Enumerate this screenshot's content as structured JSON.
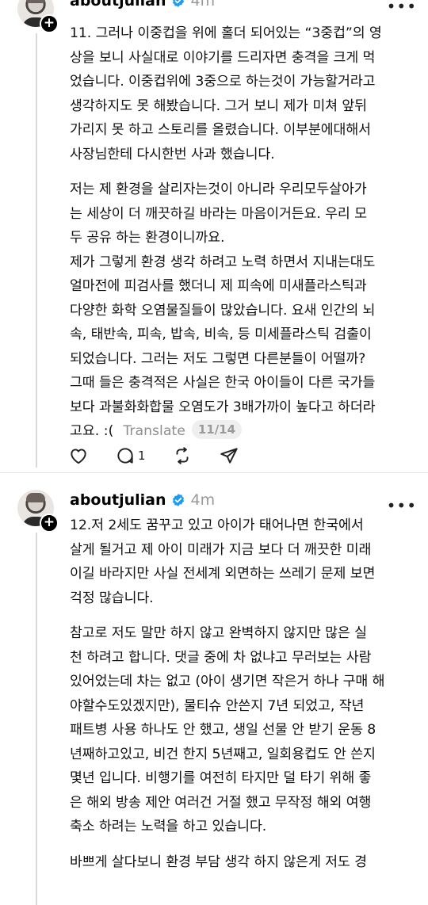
{
  "post1": {
    "username": "aboutjulian",
    "time": "4m",
    "paragraphs": [
      "11. 그러나 이중컵을 위에 홀더 되어있는 “3중컵”의 영\n상을 보니 사실대로 이야기를 드리자면 충격을 크게 먹\n었습니다. 이중컵위에 3중으로 하는것이 가능할거라고\n생각하지도 못 해봤습니다. 그거 보니 제가 미쳐 앞뒤\n가리지 못 하고 스토리를 올렸습니다. 이부분에대해서\n사장님한테 다시한번 사과 했습니다.",
      "저는 제 환경을 살리자는것이 아니라 우리모두살아가\n는 세상이 더 깨끗하길 바라는 마음이거든요. 우리 모\n두 공유 하는 환경이니까요.\n제가 그렇게 환경 생각 하려고 노력 하면서 지내는대도\n얼마전에 피검사를 했더니 제 피속에 미새플라스틱과\n다양한 화학 오염물질들이 많았습니다. 요새 인간의 뇌\n속, 태반속, 피속, 밥속, 비속, 등 미세플라스틱 검출이\n되었습니다. 그러는 저도 그렇면 다른분들이 어떨까?\n그때 들은 충격적은 사실은 한국 아이들이 다른 국가들\n보다 과불화화합물 오염도가 3배가까이 높다고 하더라"
    ],
    "last_line": "고요. :(",
    "translate_label": "Translate",
    "page_indicator": "11/14",
    "reply_count": "1"
  },
  "post2": {
    "username": "aboutjulian",
    "time": "4m",
    "paragraphs": [
      "12.저 2세도 꿈꾸고 있고 아이가 태어나면 한국에서\n살게 될거고 제 아이 미래가 지금 보다 더 깨끗한 미래\n이길 바라지만 사실 전세계 외면하는 쓰레기 문제 보면\n걱정 많습니다.",
      "참고로 저도 말만 하지 않고 완벽하지 않지만 많은 실\n천 하려고 합니다. 댓글 중에 차 없냐고 무러보는 사람\n있어었는데 차는 없고 (아이 생기면 작은거 하나 구매 해\n야할수도있겠지만), 물티슈 안쓴지 7년 되었고, 작년\n패트병 사용 하나도 안 했고, 생일 선물 안 받기 운동 8\n년째하고있고, 비건 한지 5년째고, 일회용컵도 안 쓴지\n몇년 입니다. 비행기를 여전히 타지만 덜 타기 위해 좋\n은 해외 방송 제안 여러건 거절 했고 무작정 해외 여행\n축소 하려는 노력을 하고 있습니다.",
      "바쁘게 살다보니 환경 부담 생각 하지 않은게 저도 경"
    ]
  },
  "icons": {
    "verified": "verified-badge-icon",
    "like": "heart-icon",
    "reply": "comment-icon",
    "repost": "repost-icon",
    "share": "send-icon",
    "follow": "plus-icon"
  },
  "colors": {
    "verified": "#1d9bf0",
    "muted": "#999999"
  }
}
